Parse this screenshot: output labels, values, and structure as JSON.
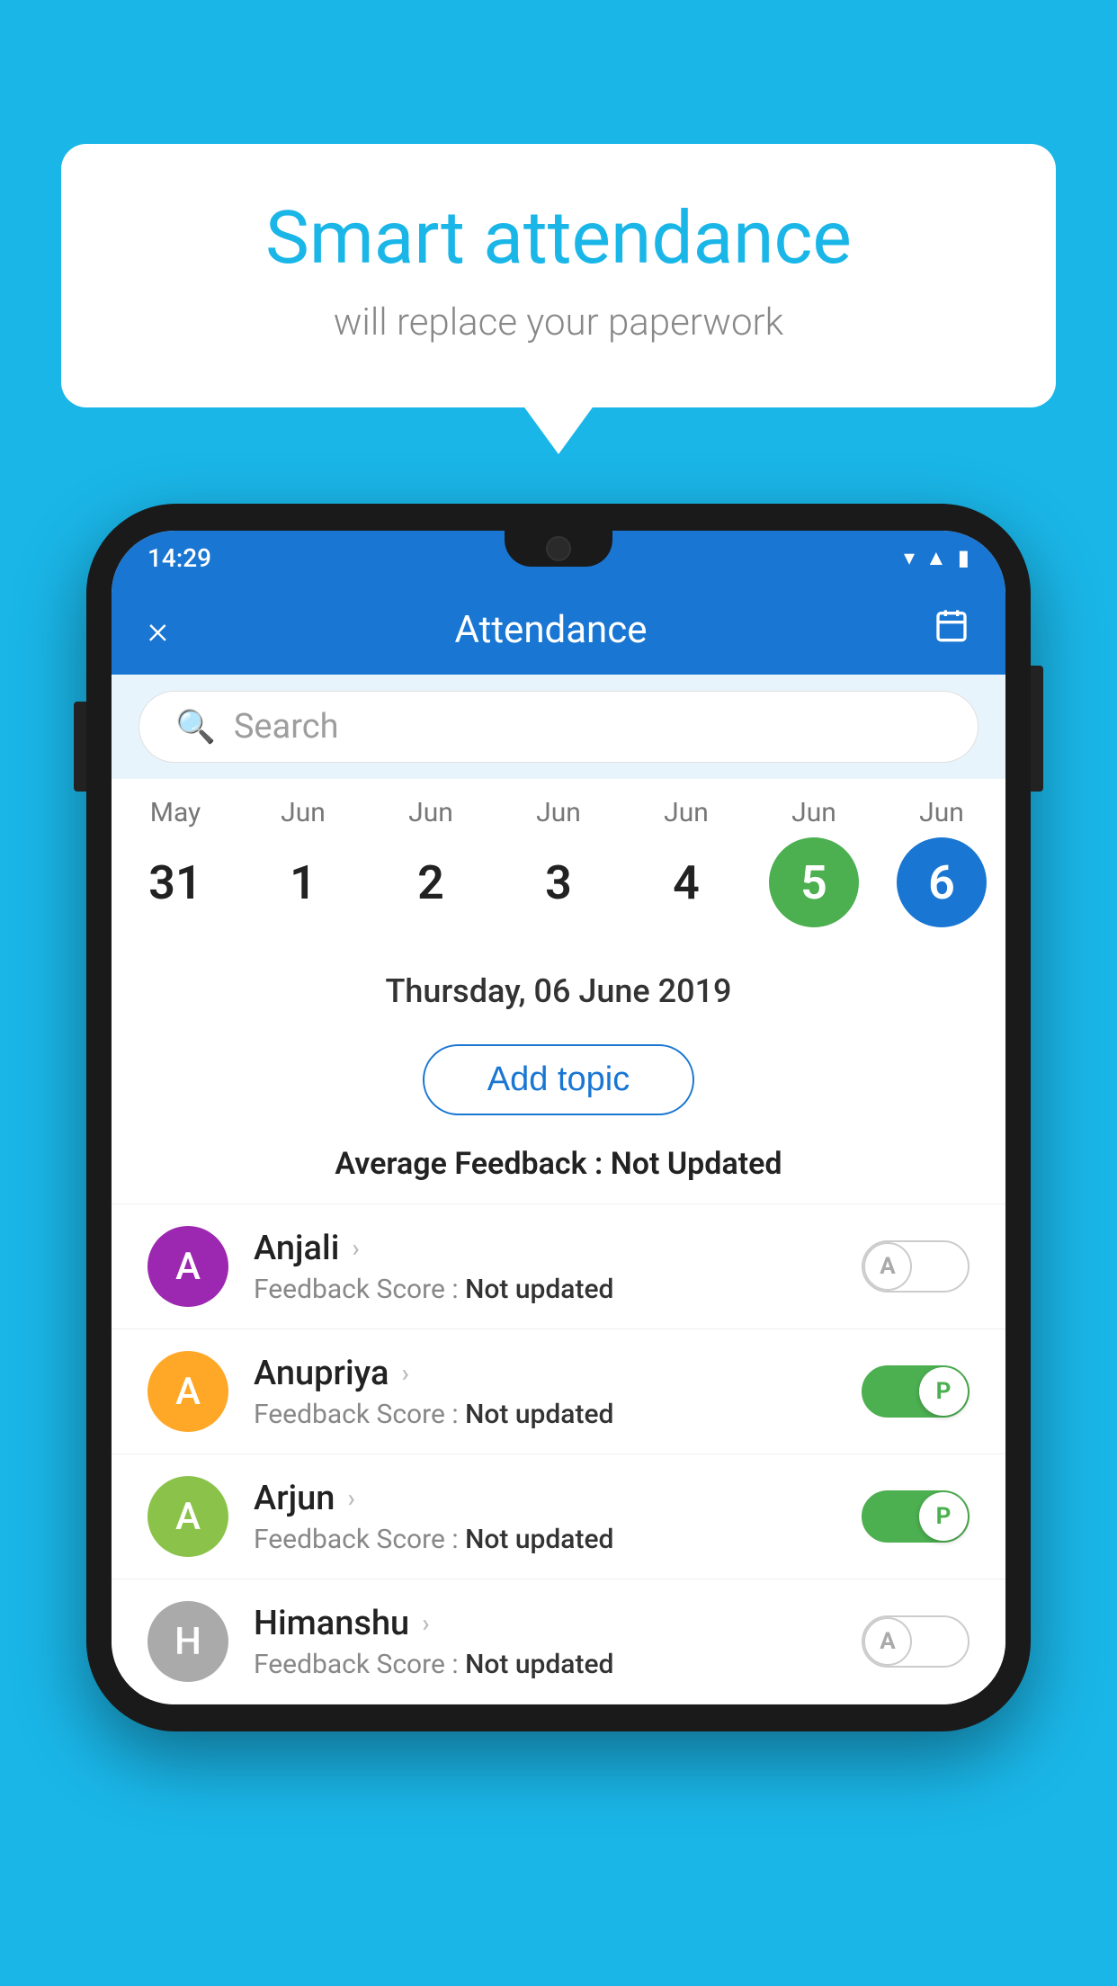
{
  "background_color": "#1ab6e8",
  "speech_bubble": {
    "title": "Smart attendance",
    "subtitle": "will replace your paperwork"
  },
  "status_bar": {
    "time": "14:29",
    "icons": [
      "wifi",
      "signal",
      "battery"
    ]
  },
  "app_bar": {
    "title": "Attendance",
    "close_label": "×",
    "calendar_label": "📅"
  },
  "search": {
    "placeholder": "Search"
  },
  "calendar": {
    "days": [
      {
        "month": "May",
        "day": "31",
        "state": "normal"
      },
      {
        "month": "Jun",
        "day": "1",
        "state": "normal"
      },
      {
        "month": "Jun",
        "day": "2",
        "state": "normal"
      },
      {
        "month": "Jun",
        "day": "3",
        "state": "normal"
      },
      {
        "month": "Jun",
        "day": "4",
        "state": "normal"
      },
      {
        "month": "Jun",
        "day": "5",
        "state": "today"
      },
      {
        "month": "Jun",
        "day": "6",
        "state": "selected"
      }
    ]
  },
  "selected_date": "Thursday, 06 June 2019",
  "add_topic_label": "Add topic",
  "average_feedback_label": "Average Feedback :",
  "average_feedback_value": "Not Updated",
  "students": [
    {
      "name": "Anjali",
      "avatar_letter": "A",
      "avatar_color": "#9c27b0",
      "feedback_label": "Feedback Score :",
      "feedback_value": "Not updated",
      "toggle_state": "off",
      "toggle_letter": "A"
    },
    {
      "name": "Anupriya",
      "avatar_letter": "A",
      "avatar_color": "#ffa726",
      "feedback_label": "Feedback Score :",
      "feedback_value": "Not updated",
      "toggle_state": "on",
      "toggle_letter": "P"
    },
    {
      "name": "Arjun",
      "avatar_letter": "A",
      "avatar_color": "#8bc34a",
      "feedback_label": "Feedback Score :",
      "feedback_value": "Not updated",
      "toggle_state": "on",
      "toggle_letter": "P"
    },
    {
      "name": "Himanshu",
      "avatar_letter": "H",
      "avatar_color": "#aaa",
      "feedback_label": "Feedback Score :",
      "feedback_value": "Not updated",
      "toggle_state": "off",
      "toggle_letter": "A"
    }
  ]
}
